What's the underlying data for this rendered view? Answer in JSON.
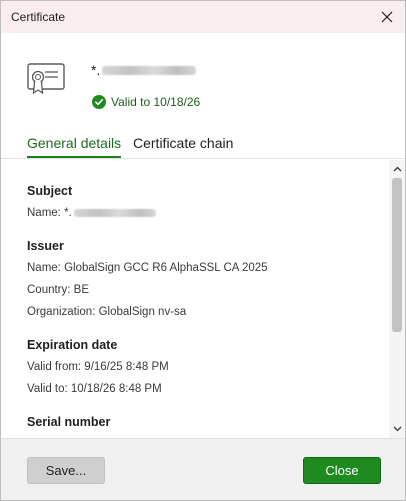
{
  "window": {
    "title": "Certificate"
  },
  "certificate": {
    "domain_prefix": "*.",
    "validity": "Valid to 10/18/26"
  },
  "tabs": [
    {
      "label": "General details",
      "selected": true
    },
    {
      "label": "Certificate chain",
      "selected": false
    }
  ],
  "subject": {
    "title": "Subject",
    "name_label": "Name: *."
  },
  "issuer": {
    "title": "Issuer",
    "name": "Name: GlobalSign GCC R6 AlphaSSL CA 2025",
    "country": "Country: BE",
    "organization": "Organization: GlobalSign nv-sa"
  },
  "expiration": {
    "title": "Expiration date",
    "valid_from": "Valid from: 9/16/25 8:48 PM",
    "valid_to": "Valid to: 10/18/26 8:48 PM"
  },
  "serial": {
    "title": "Serial number"
  },
  "footer": {
    "save_label": "Save...",
    "close_label": "Close"
  },
  "colors": {
    "accent_green": "#1f8a1f",
    "titlebar_bg": "#f9eded"
  },
  "icons": [
    "close-icon",
    "certificate-icon",
    "check-circle-icon",
    "chevron-up-icon",
    "chevron-down-icon"
  ]
}
